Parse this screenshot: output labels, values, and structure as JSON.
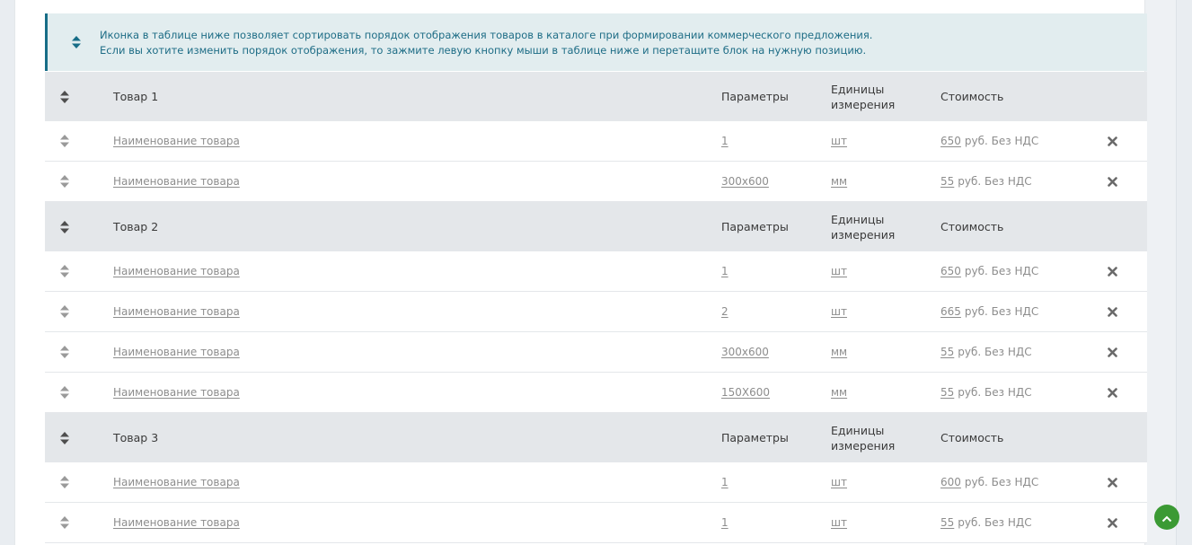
{
  "notice": {
    "line1": "Иконка в таблице ниже позволяет сортировать порядок отображения товаров в каталоге при формировании коммерческого предложения.",
    "line2": "Если вы хотите изменить порядок отображения, то зажмите левую кнопку мыши в таблице ниже и перетащите блок на нужную позицию."
  },
  "columns": {
    "params": "Параметры",
    "unit_line1": "Единицы",
    "unit_line2": "измерения",
    "cost": "Стоимость"
  },
  "groups": [
    {
      "title": "Товар 1",
      "items": [
        {
          "name": "Наименование товара",
          "param": "1",
          "unit": "шт",
          "price": "650",
          "price_suffix": "руб. Без НДС"
        },
        {
          "name": "Наименование товара",
          "param": "300x600",
          "unit": "мм",
          "price": "55",
          "price_suffix": "руб. Без НДС"
        }
      ]
    },
    {
      "title": "Товар 2",
      "items": [
        {
          "name": "Наименование товара",
          "param": "1",
          "unit": "шт",
          "price": "650",
          "price_suffix": "руб. Без НДС"
        },
        {
          "name": "Наименование товара",
          "param": "2",
          "unit": "шт",
          "price": "665",
          "price_suffix": "руб. Без НДС"
        },
        {
          "name": "Наименование товара",
          "param": "300x600",
          "unit": "мм",
          "price": "55",
          "price_suffix": "руб. Без НДС"
        },
        {
          "name": "Наименование товара",
          "param": "150X600",
          "unit": "мм",
          "price": "55",
          "price_suffix": "руб. Без НДС"
        }
      ]
    },
    {
      "title": "Товар 3",
      "items": [
        {
          "name": "Наименование товара",
          "param": "1",
          "unit": "шт",
          "price": "600",
          "price_suffix": "руб. Без НДС"
        },
        {
          "name": "Наименование товара",
          "param": "1",
          "unit": "шт",
          "price": "55",
          "price_suffix": "руб. Без НДС"
        }
      ]
    }
  ],
  "icons": {
    "notice": "sort-icon",
    "drag": "sort-icon",
    "delete": "close-icon",
    "scroll_top": "chevron-up-icon"
  },
  "colors": {
    "accent": "#176d87",
    "notice_bg": "#e2edef",
    "header_bg": "#e4e7ea",
    "scroll_top": "#3b9a34"
  }
}
